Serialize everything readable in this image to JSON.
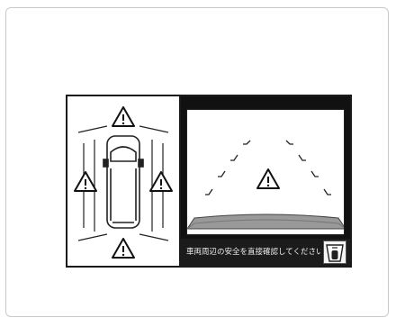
{
  "status_bar": {
    "message": "車両周辺の安全を直接確認してください"
  },
  "icons": {
    "warning": "warning-triangle-icon",
    "view_switch": "camera-view-switch-icon"
  },
  "colors": {
    "frame_border": "#c9c9c9",
    "screen_border": "#1a1a1a",
    "status_bar_bg": "#1b1b1b",
    "status_text": "#f2f2f2"
  }
}
